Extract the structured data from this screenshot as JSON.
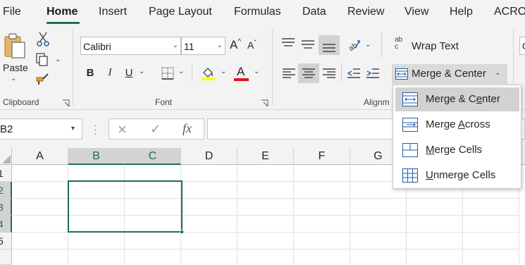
{
  "menu": {
    "items": [
      "File",
      "Home",
      "Insert",
      "Page Layout",
      "Formulas",
      "Data",
      "Review",
      "View",
      "Help",
      "ACRO"
    ],
    "active": "Home"
  },
  "ribbon": {
    "clipboard": {
      "paste_label": "Paste",
      "group_label": "Clipboard"
    },
    "font": {
      "font_name": "Calibri",
      "font_size": "11",
      "bold": "B",
      "italic": "I",
      "underline": "U",
      "grow": "A",
      "shrink": "A",
      "font_color_letter": "A",
      "group_label": "Font",
      "highlight_color": "#ffff00",
      "font_color": "#e81123"
    },
    "alignment": {
      "wrap_text_label": "Wrap Text",
      "wrap_icon_text": "ab c",
      "merge_center_label": "Merge & Center",
      "group_label": "Alignm",
      "number_format_partial": "G"
    }
  },
  "formula_bar": {
    "name_box": "B2",
    "cancel_icon": "×",
    "enter_icon": "✓",
    "fx": "fx",
    "content": ""
  },
  "grid": {
    "columns": [
      "A",
      "B",
      "C",
      "D",
      "E",
      "F",
      "G"
    ],
    "rows": [
      "1",
      "2",
      "3",
      "4",
      "5"
    ],
    "selected_columns": [
      "B",
      "C"
    ],
    "selected_rows": [
      "2",
      "3",
      "4"
    ],
    "accent": "#1e7145"
  },
  "merge_menu": {
    "items": [
      {
        "label": "Merge & Center",
        "highlighted": true
      },
      {
        "label": "Merge Across",
        "highlighted": false
      },
      {
        "label": "Merge Cells",
        "highlighted": false
      },
      {
        "label": "Unmerge Cells",
        "highlighted": false
      }
    ]
  }
}
